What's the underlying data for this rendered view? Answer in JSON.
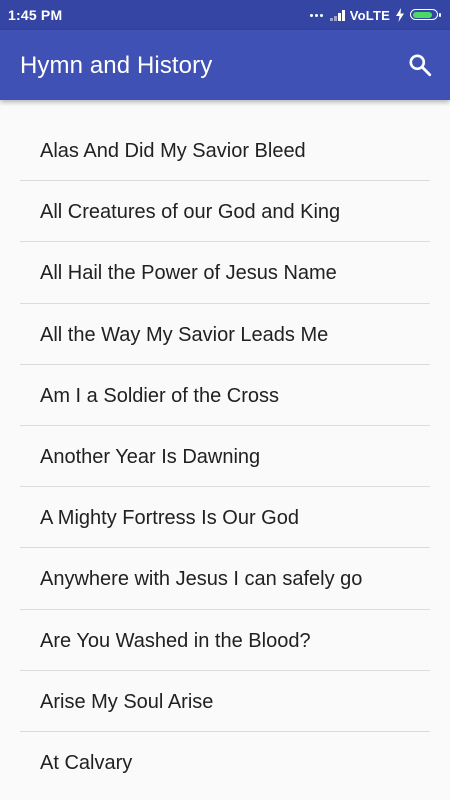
{
  "status_bar": {
    "time": "1:45 PM",
    "network": "VoLTE",
    "battery_color": "#4cd964",
    "battery_level": 0.85
  },
  "app_bar": {
    "title": "Hymn and History",
    "background": "#3f51b5",
    "search_icon": "search-icon"
  },
  "hymns": [
    "Alas And Did My Savior Bleed",
    "All Creatures of our God and King",
    "All Hail the Power of Jesus Name",
    "All the Way My Savior Leads Me",
    "Am I a Soldier of the Cross",
    "Another Year Is Dawning",
    "A Mighty Fortress Is Our God",
    "Anywhere with Jesus I can safely go",
    "Are You Washed in the Blood?",
    "Arise My Soul Arise",
    "At Calvary"
  ]
}
